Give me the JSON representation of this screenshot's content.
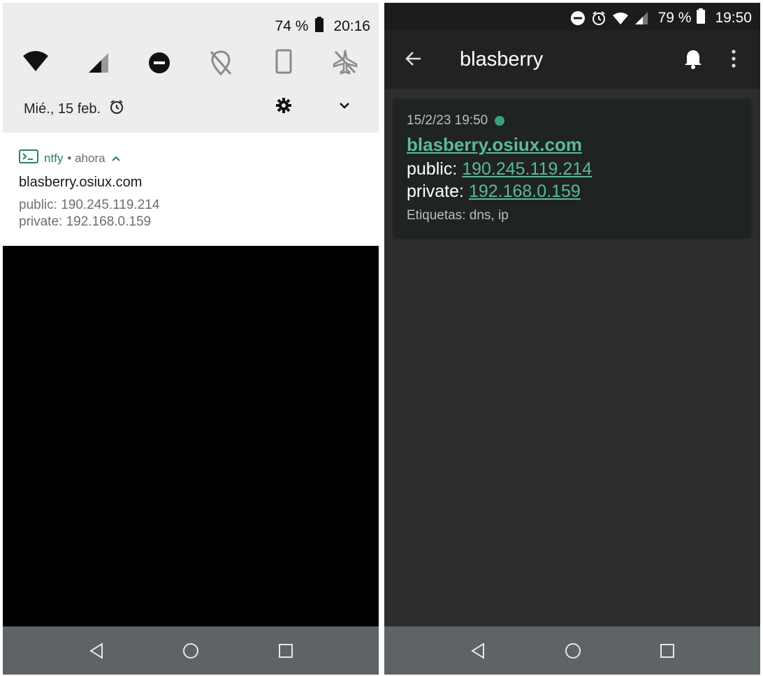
{
  "left": {
    "quick_settings": {
      "battery_percent": "74 %",
      "clock": "20:16",
      "date": "Mié., 15 feb.",
      "tiles": [
        {
          "icon": "wifi-icon"
        },
        {
          "icon": "cell-signal-icon"
        },
        {
          "icon": "do-not-disturb-icon"
        },
        {
          "icon": "location-off-icon"
        },
        {
          "icon": "auto-rotate-icon"
        },
        {
          "icon": "airplane-mode-off-icon"
        }
      ]
    },
    "notification": {
      "app_name": "ntfy",
      "time": "• ahora",
      "title": "blasberry.osiux.com",
      "line_public": "public: 190.245.119.214",
      "line_private": "private: 192.168.0.159"
    }
  },
  "right": {
    "status": {
      "battery_percent": "79 %",
      "clock": "19:50"
    },
    "appbar": {
      "title": "blasberry"
    },
    "message": {
      "timestamp": "15/2/23 19:50",
      "title": "blasberry.osiux.com",
      "public_label": "public:",
      "public_ip": "190.245.119.214",
      "private_label": "private:",
      "private_ip": "192.168.0.159",
      "tags": "Etiquetas: dns, ip"
    }
  },
  "colors": {
    "accent": "#5bb99c",
    "ntfy_green": "#2e7d6a",
    "navbar": "#5e6366",
    "dark_bg": "#2d2d2d"
  }
}
